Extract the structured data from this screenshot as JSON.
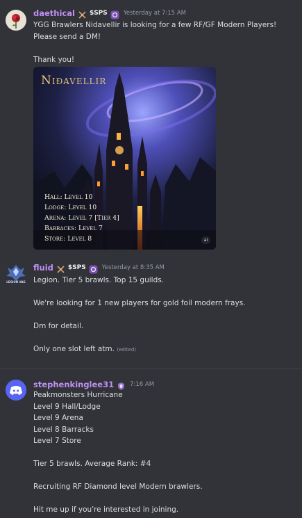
{
  "messages": [
    {
      "username": "daethical",
      "role_tag": "$SPS",
      "timestamp": "Yesterday at 7:15 AM",
      "lines": [
        "YGG Brawlers Nidavellir is looking for a few RF/GF Modern Players!",
        "Please send a DM!",
        "",
        "Thank you!"
      ],
      "embed": {
        "brand": "Niðavellir",
        "stats": [
          "Hall: Level 10",
          "Lodge: Level 10",
          "Arena: Level 7 [Tier 4]",
          "Barracks: Level 7",
          "Store: Level 8"
        ],
        "badge": "ai"
      }
    },
    {
      "username": "fluid",
      "role_tag": "$SPS",
      "timestamp": "Yesterday at 8:35 AM",
      "avatar_text": "LEGION VAG",
      "lines": [
        "Legion. Tier 5 brawls. Top 15 guilds.",
        "",
        "We're looking for 1 new players for gold foil modern frays.",
        "",
        "Dm for detail.",
        "",
        "Only one slot left atm."
      ],
      "edited_label": "(edited)"
    },
    {
      "username": "stephenkinglee31",
      "timestamp": "7:16 AM",
      "lines": [
        "Peakmonsters Hurricane",
        "Level 9 Hall/Lodge",
        "Level 9 Arena",
        "Level 8 Barracks",
        "Level 7 Store",
        "",
        "Tier 5 brawls. Average Rank: #4",
        "",
        "Recruiting RF Diamond level Modern brawlers.",
        "",
        "Hit me up if you're interested in joining."
      ]
    }
  ],
  "colors": {
    "background": "#313338",
    "username": "#c08ff5",
    "text": "#dbdee1",
    "timestamp": "#949ba4",
    "discord_blurple": "#5865f2"
  }
}
